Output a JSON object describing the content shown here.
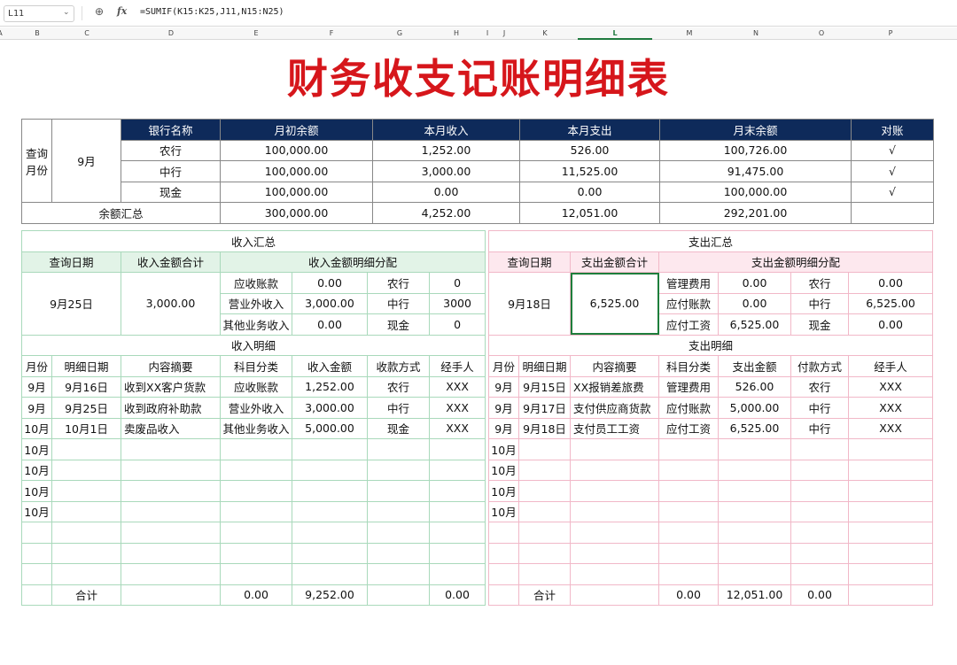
{
  "formula_bar": {
    "name_box": "L11",
    "formula": "=SUMIF(K15:K25,J11,N15:N25)"
  },
  "column_headers": [
    "A",
    "B",
    "C",
    "D",
    "E",
    "F",
    "G",
    "H",
    "I",
    "J",
    "K",
    "L",
    "M",
    "N",
    "O",
    "P"
  ],
  "title": "财务收支记账明细表",
  "summary": {
    "query_label": "查询\n月份",
    "query_month": "9月",
    "headers": [
      "银行名称",
      "月初余额",
      "本月收入",
      "本月支出",
      "月末余额",
      "对账"
    ],
    "rows": [
      [
        "农行",
        "100,000.00",
        "1,252.00",
        "526.00",
        "100,726.00",
        "√"
      ],
      [
        "中行",
        "100,000.00",
        "3,000.00",
        "11,525.00",
        "91,475.00",
        "√"
      ],
      [
        "现金",
        "100,000.00",
        "0.00",
        "0.00",
        "100,000.00",
        "√"
      ]
    ],
    "total_label": "余额汇总",
    "totals": [
      "300,000.00",
      "4,252.00",
      "12,051.00",
      "292,201.00"
    ]
  },
  "income": {
    "summary_title": "收入汇总",
    "heads": [
      "查询日期",
      "收入金额合计",
      "收入金额明细分配"
    ],
    "query_date": "9月25日",
    "total": "3,000.00",
    "alloc": [
      [
        "应收账款",
        "0.00",
        "农行",
        "0"
      ],
      [
        "营业外收入",
        "3,000.00",
        "中行",
        "3000"
      ],
      [
        "其他业务收入",
        "0.00",
        "现金",
        "0"
      ]
    ],
    "detail_title": "收入明细",
    "detail_headers": [
      "月份",
      "明细日期",
      "内容摘要",
      "科目分类",
      "收入金额",
      "收款方式",
      "经手人"
    ],
    "rows": [
      [
        "9月",
        "9月16日",
        "收到XX客户货款",
        "应收账款",
        "1,252.00",
        "农行",
        "XXX"
      ],
      [
        "9月",
        "9月25日",
        "收到政府补助款",
        "营业外收入",
        "3,000.00",
        "中行",
        "XXX"
      ],
      [
        "10月",
        "10月1日",
        "卖废品收入",
        "其他业务收入",
        "5,000.00",
        "现金",
        "XXX"
      ],
      [
        "10月",
        "",
        "",
        "",
        "",
        "",
        ""
      ],
      [
        "10月",
        "",
        "",
        "",
        "",
        "",
        ""
      ],
      [
        "10月",
        "",
        "",
        "",
        "",
        "",
        ""
      ],
      [
        "10月",
        "",
        "",
        "",
        "",
        "",
        ""
      ],
      [
        "",
        "",
        "",
        "",
        "",
        "",
        ""
      ],
      [
        "",
        "",
        "",
        "",
        "",
        "",
        ""
      ],
      [
        "",
        "",
        "",
        "",
        "",
        "",
        ""
      ]
    ],
    "total_row": [
      "",
      "合计",
      "",
      "0.00",
      "9,252.00",
      "",
      "0.00"
    ]
  },
  "expense": {
    "summary_title": "支出汇总",
    "heads": [
      "查询日期",
      "支出金额合计",
      "支出金额明细分配"
    ],
    "query_date": "9月18日",
    "total": "6,525.00",
    "alloc": [
      [
        "管理费用",
        "0.00",
        "农行",
        "0.00"
      ],
      [
        "应付账款",
        "0.00",
        "中行",
        "6,525.00"
      ],
      [
        "应付工资",
        "6,525.00",
        "现金",
        "0.00"
      ]
    ],
    "detail_title": "支出明细",
    "detail_headers": [
      "月份",
      "明细日期",
      "内容摘要",
      "科目分类",
      "支出金额",
      "付款方式",
      "经手人"
    ],
    "rows": [
      [
        "9月",
        "9月15日",
        "XX报销差旅费",
        "管理费用",
        "526.00",
        "农行",
        "XXX"
      ],
      [
        "9月",
        "9月17日",
        "支付供应商货款",
        "应付账款",
        "5,000.00",
        "中行",
        "XXX"
      ],
      [
        "9月",
        "9月18日",
        "支付员工工资",
        "应付工资",
        "6,525.00",
        "中行",
        "XXX"
      ],
      [
        "10月",
        "",
        "",
        "",
        "",
        "",
        ""
      ],
      [
        "10月",
        "",
        "",
        "",
        "",
        "",
        ""
      ],
      [
        "10月",
        "",
        "",
        "",
        "",
        "",
        ""
      ],
      [
        "10月",
        "",
        "",
        "",
        "",
        "",
        ""
      ],
      [
        "",
        "",
        "",
        "",
        "",
        "",
        ""
      ],
      [
        "",
        "",
        "",
        "",
        "",
        "",
        ""
      ],
      [
        "",
        "",
        "",
        "",
        "",
        "",
        ""
      ]
    ],
    "total_row": [
      "",
      "合计",
      "",
      "0.00",
      "12,051.00",
      "0.00",
      ""
    ]
  }
}
